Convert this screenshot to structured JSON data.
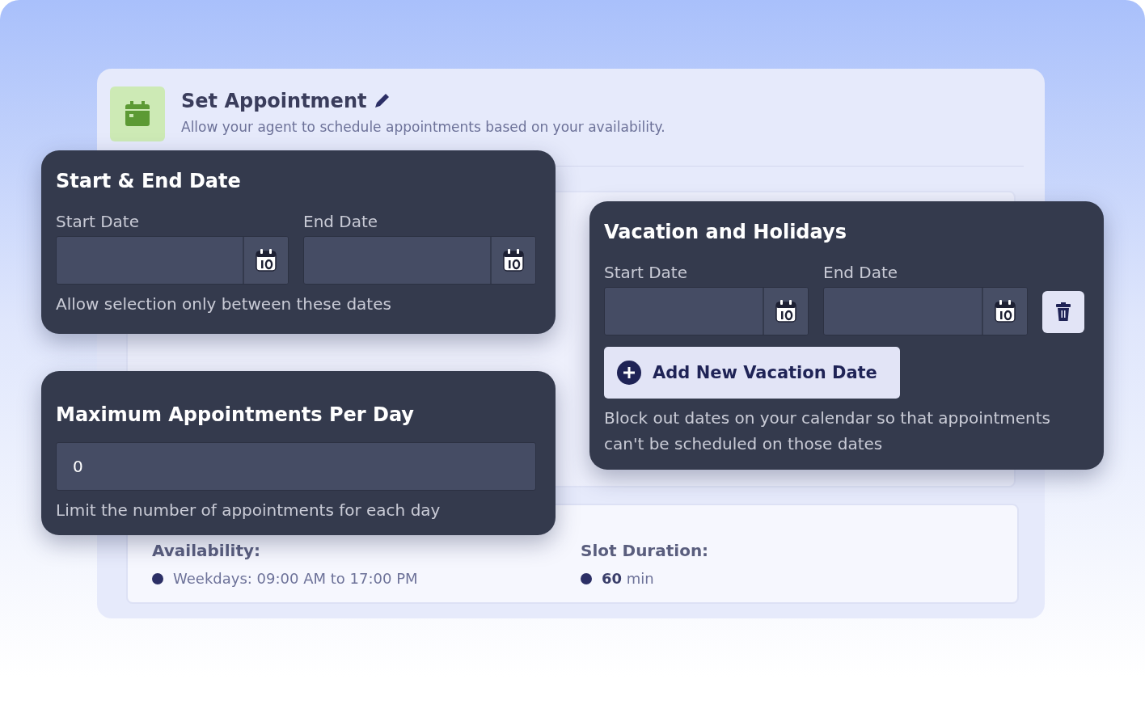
{
  "background_card": {
    "title": "Set Appointment",
    "description": "Allow your agent to schedule appointments based on your availability.",
    "summary": [
      {
        "label": "Availability:",
        "value": "Weekdays: 09:00 AM to 17:00 PM"
      },
      {
        "label": "Slot Duration:",
        "value": "**60** min"
      }
    ]
  },
  "start_end_card": {
    "title": "Start & End Date",
    "fields": [
      {
        "label": "Start Date"
      },
      {
        "label": "End Date"
      }
    ],
    "hint": "Allow selection only between these dates"
  },
  "max_card": {
    "title": "Maximum Appointments Per Day",
    "value": "0",
    "hint": "Limit the number of appointments for each day"
  },
  "vacation_card": {
    "title": "Vacation and Holidays",
    "fields": [
      {
        "label": "Start Date"
      },
      {
        "label": "End Date"
      }
    ],
    "add_button": "Add New Vacation Date",
    "hint": "Block out dates on your calendar so that appointments can't be scheduled on those dates"
  }
}
